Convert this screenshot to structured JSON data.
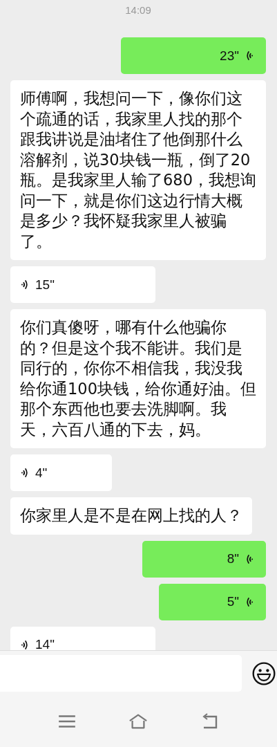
{
  "timestamp": "14:09",
  "messages": [
    {
      "kind": "voice",
      "outgoing": true,
      "duration": "23\""
    },
    {
      "kind": "text",
      "outgoing": false,
      "text": "师傅啊，我想问一下，像你们这个疏通的话，我家里人找的那个跟我讲说是油堵住了他倒那什么溶解剂，说30块钱一瓶，倒了20瓶。是我家里人输了680，我想询问一下，就是你们这边行情大概是多少？我怀疑我家里人被骗了。"
    },
    {
      "kind": "voice",
      "outgoing": false,
      "duration": "15\""
    },
    {
      "kind": "text",
      "outgoing": false,
      "text": "你们真傻呀，哪有什么他骗你的？但是这个我不能讲。我们是同行的，你你不相信我，我没我给你通100块钱，给你通好油。但那个东西他也要去洗脚啊。我天，六百八通的下去，妈。"
    },
    {
      "kind": "voice",
      "outgoing": false,
      "duration": "4\""
    },
    {
      "kind": "text",
      "outgoing": false,
      "text": "你家里人是不是在网上找的人？"
    },
    {
      "kind": "voice",
      "outgoing": true,
      "duration": "8\""
    },
    {
      "kind": "voice",
      "outgoing": true,
      "duration": "5\""
    },
    {
      "kind": "voice",
      "outgoing": false,
      "duration": "14\""
    }
  ]
}
